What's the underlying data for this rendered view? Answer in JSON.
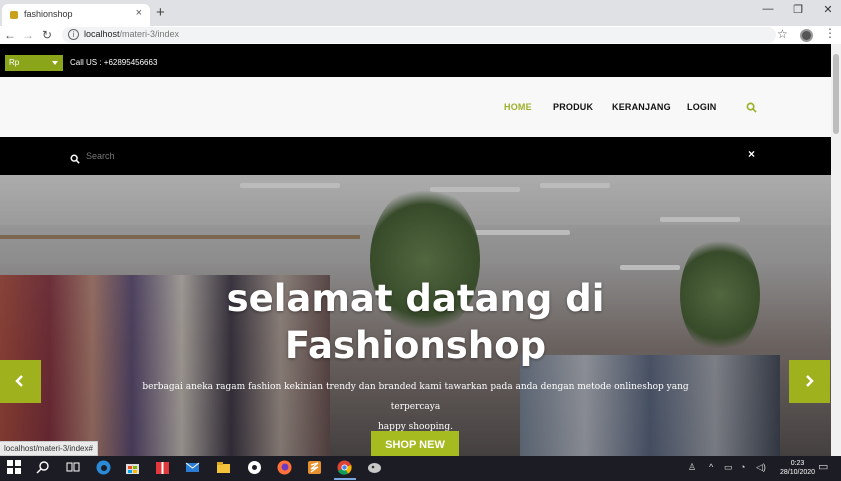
{
  "browser": {
    "tab_title": "fashionshop",
    "tab_close": "×",
    "new_tab": "+",
    "url_host": "localhost",
    "url_path": "/materi-3/index",
    "status_link": "localhost/materi-3/index#"
  },
  "topbar": {
    "currency_label": "Rp",
    "call_us": "Call US : +62895456663"
  },
  "nav": {
    "items": [
      "HOME",
      "PRODUK",
      "KERANJANG",
      "LOGIN"
    ],
    "active": "HOME"
  },
  "search": {
    "placeholder": "Search",
    "close": "×"
  },
  "hero": {
    "title_line1": "selamat datang di",
    "title_line2": "Fashionshop",
    "text_line1": "berbagai aneka ragam fashion kekinian trendy dan branded kami tawarkan pada anda dengan metode onlineshop yang terpercaya",
    "text_line2": "happy shooping.",
    "button": "SHOP NEW"
  },
  "taskbar": {
    "time": "0:23",
    "date": "28/10/2020"
  },
  "colors": {
    "accent": "#9fb21d",
    "topbar_bg": "#000000",
    "nav_bg": "#f8f8f8"
  },
  "icons": [
    "search-icon",
    "close-icon",
    "chevron-left-icon",
    "chevron-right-icon",
    "windows-start-icon",
    "chrome-icon",
    "firefox-icon",
    "edge-icon"
  ]
}
